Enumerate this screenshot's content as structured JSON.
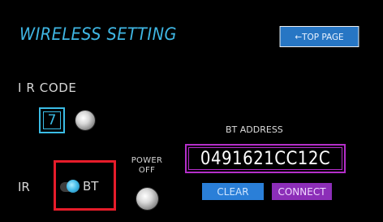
{
  "header": {
    "title": "WIRELESS SETTING",
    "top_page_button": "←TOP PAGE"
  },
  "ir_code": {
    "label": "I R CODE",
    "value": "7"
  },
  "mode": {
    "ir_label": "IR",
    "bt_label": "BT",
    "selected": "BT"
  },
  "power": {
    "label_line1": "POWER",
    "label_line2": "OFF"
  },
  "bt": {
    "address_label": "BT ADDRESS",
    "address_value": "0491621CC12C",
    "clear_button": "CLEAR",
    "connect_button": "CONNECT"
  },
  "colors": {
    "background": "#000000",
    "title_cyan": "#3fb6e3",
    "top_button_blue": "#2776c4",
    "highlight_red": "#e61c2a",
    "address_purple": "#b42ec9",
    "clear_blue": "#2a7fd8",
    "connect_purple": "#8c2eb8"
  },
  "icons": [
    "ir-code-knob-icon",
    "power-knob-icon",
    "mode-toggle-icon"
  ]
}
